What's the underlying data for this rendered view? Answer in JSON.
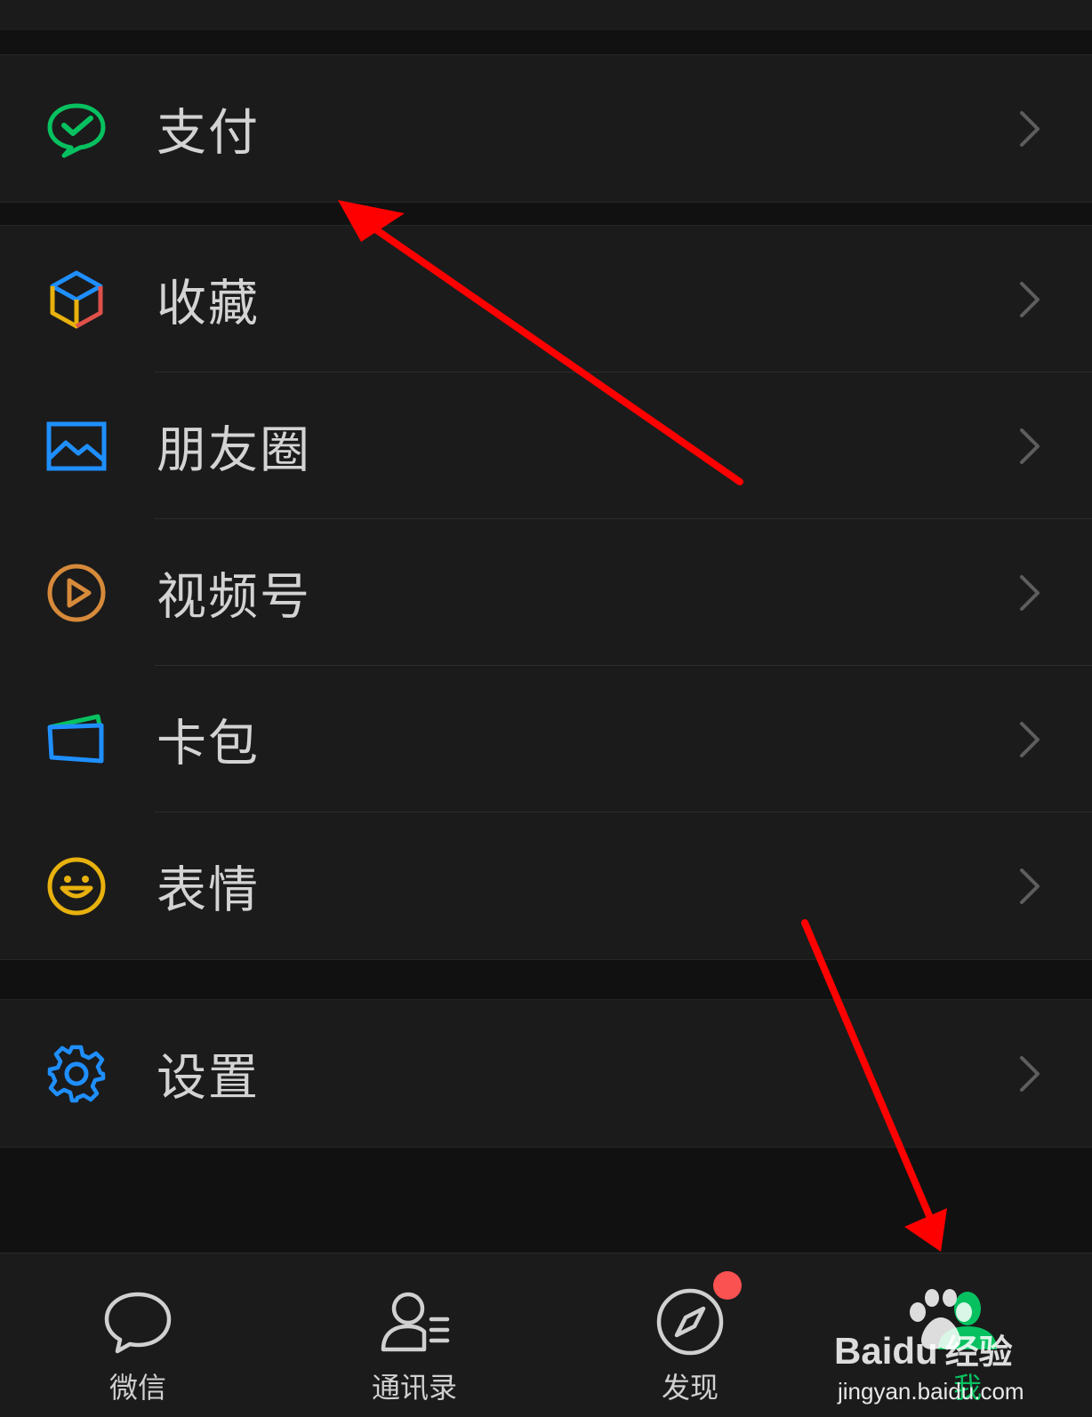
{
  "menu": {
    "pay": {
      "label": "支付",
      "icon": "pay-icon",
      "color": "#07c160"
    },
    "items": [
      {
        "label": "收藏",
        "icon": "favorites-cube-icon"
      },
      {
        "label": "朋友圈",
        "icon": "moments-image-icon",
        "color": "#1f8fff"
      },
      {
        "label": "视频号",
        "icon": "channels-play-icon",
        "color": "#d68a3a"
      },
      {
        "label": "卡包",
        "icon": "card-wallet-icon",
        "color": "#1f8fff"
      },
      {
        "label": "表情",
        "icon": "sticker-smile-icon",
        "color": "#e8b10d"
      }
    ],
    "settings": {
      "label": "设置",
      "icon": "gear-icon",
      "color": "#1f8fff"
    }
  },
  "tabbar": {
    "tabs": [
      {
        "label": "微信",
        "icon": "chat-bubble-icon"
      },
      {
        "label": "通讯录",
        "icon": "contacts-icon"
      },
      {
        "label": "发现",
        "icon": "compass-icon",
        "badge": true
      },
      {
        "label": "我",
        "icon": "me-person-icon",
        "active": true,
        "color": "#07c160"
      }
    ]
  },
  "watermark": {
    "brand": "Bai",
    "brand_suffix": "du",
    "product": "经验",
    "url": "jingyan.baidu.com"
  },
  "colors": {
    "background": "#111111",
    "card": "#1b1b1b",
    "text": "#d3d3d3",
    "annotation_arrow": "#ff0000"
  }
}
